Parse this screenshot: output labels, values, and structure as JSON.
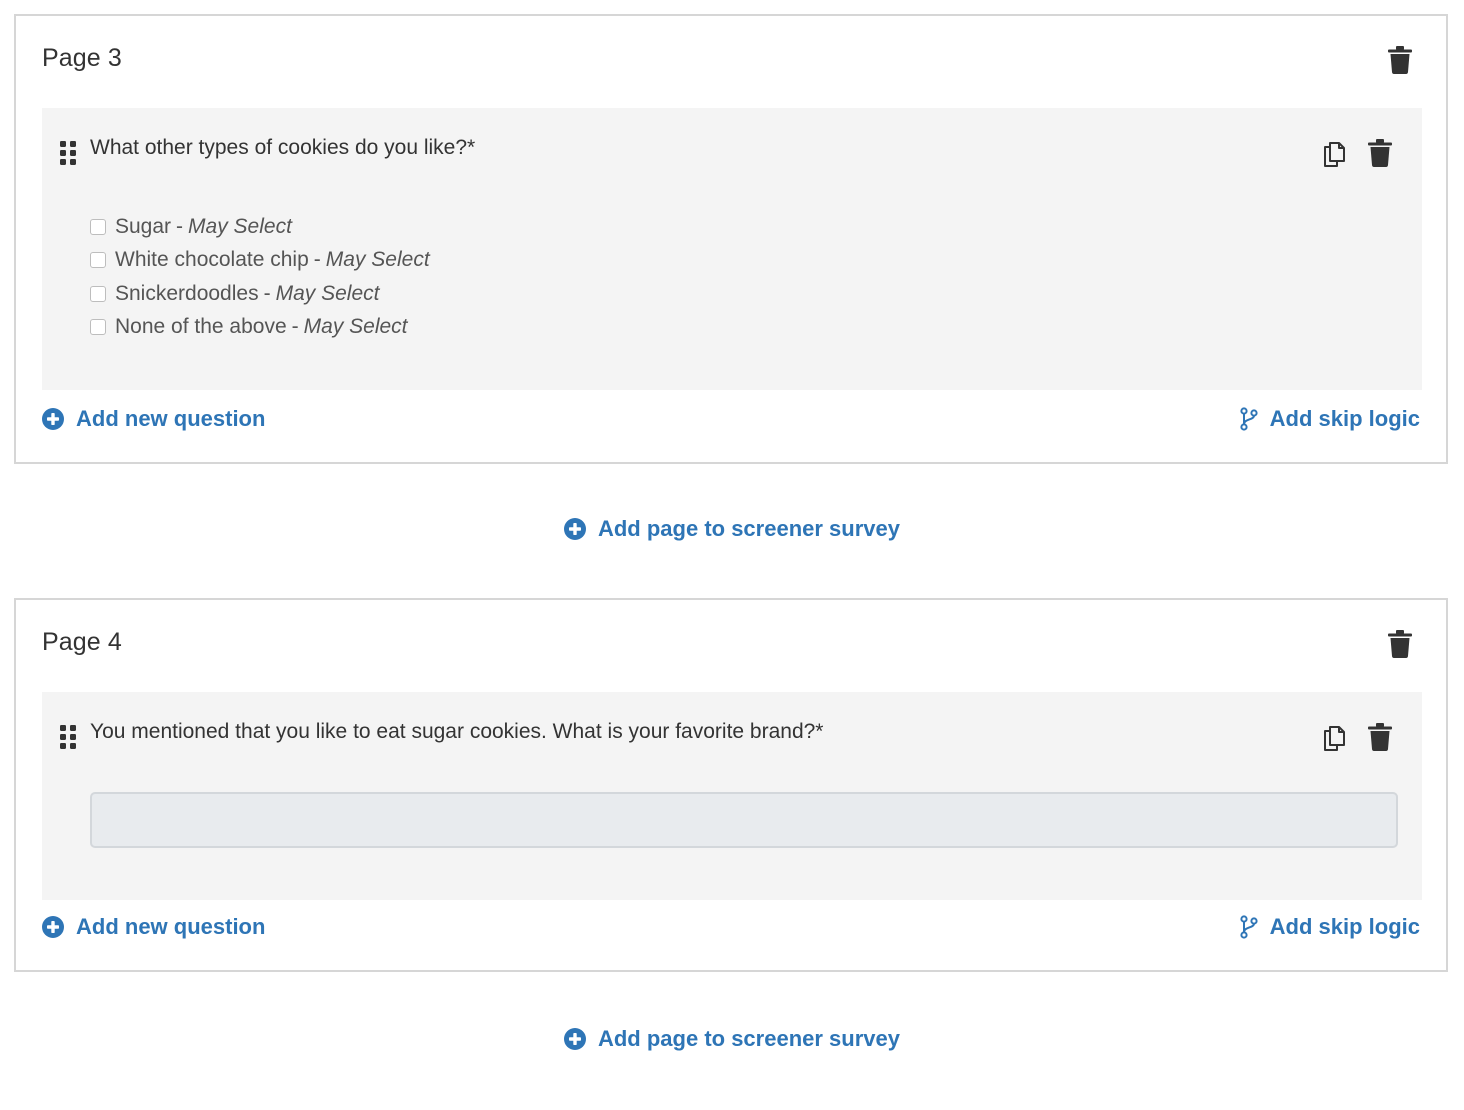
{
  "colors": {
    "accent": "#2e75b6",
    "icon": "#333333",
    "panel": "#f4f4f4",
    "border": "#d6d6d6"
  },
  "pages": [
    {
      "title": "Page 3",
      "question": {
        "text": "What other types of cookies do you like?*",
        "type": "checkbox",
        "options": [
          {
            "label": "Sugar",
            "qualifier": "May Select"
          },
          {
            "label": "White chocolate chip",
            "qualifier": "May Select"
          },
          {
            "label": "Snickerdoodles",
            "qualifier": "May Select"
          },
          {
            "label": "None of the above",
            "qualifier": "May Select"
          }
        ]
      },
      "add_question_label": "Add new question",
      "skip_logic_label": "Add skip logic"
    },
    {
      "title": "Page 4",
      "question": {
        "text": "You mentioned that you like to eat sugar cookies. What is your favorite brand?*",
        "type": "text",
        "value": "",
        "placeholder": ""
      },
      "add_question_label": "Add new question",
      "skip_logic_label": "Add skip logic"
    }
  ],
  "add_page_label": "Add page to screener survey",
  "icons": {
    "page_delete": "trash-icon",
    "question_copy": "copy-icon",
    "question_delete": "trash-icon",
    "drag": "drag-handle-icon",
    "add": "plus-circle-icon",
    "skip_logic": "branch-icon"
  }
}
